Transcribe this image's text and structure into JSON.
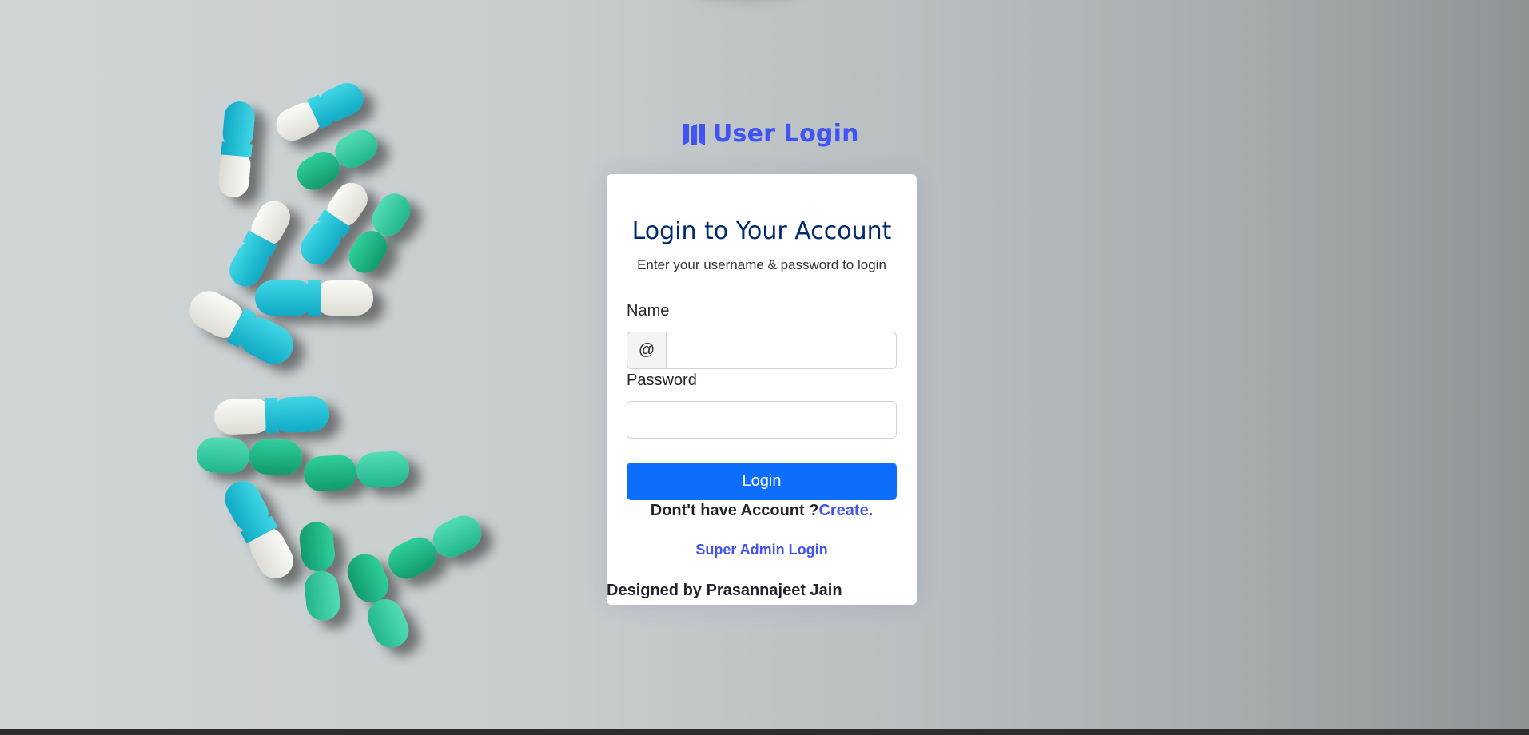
{
  "brand": {
    "logo_icon": "logo-icon",
    "title": "User Login",
    "accent": "#4154f1"
  },
  "card": {
    "title": "Login to Your Account",
    "subtitle": "Enter your username & password to login",
    "name_label": "Name",
    "name_prefix": "@",
    "name_value": "",
    "password_label": "Password",
    "password_value": "",
    "login_button": "Login",
    "signup_text": "Dont't have Account ?",
    "signup_link": "Create.",
    "admin_link": "Super Admin Login",
    "credit": "Designed by Prasannajeet Jain"
  },
  "colors": {
    "primary_button": "#0d6efd",
    "title": "#012970",
    "link": "#4154f1"
  },
  "background": {
    "image": "scattered-capsules-photo"
  }
}
